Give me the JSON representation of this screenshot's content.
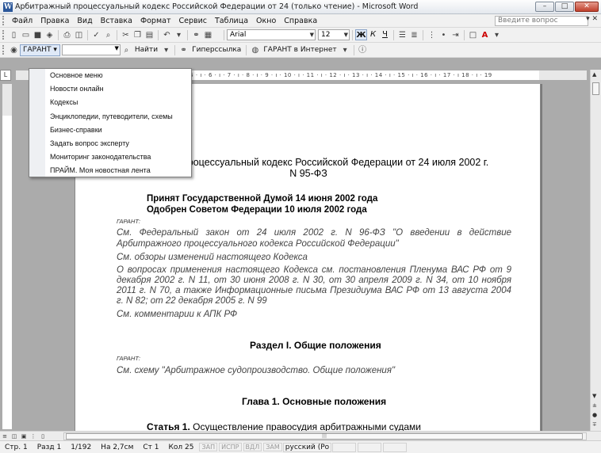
{
  "window": {
    "title": "Арбитражный процессуальный кодекс Российской Федерации от 24 (только чтение) - Microsoft Word"
  },
  "menubar": {
    "items": [
      "Файл",
      "Правка",
      "Вид",
      "Вставка",
      "Формат",
      "Сервис",
      "Таблица",
      "Окно",
      "Справка"
    ],
    "help_placeholder": "Введите вопрос"
  },
  "formatting": {
    "font_name": "Arial",
    "font_size": "12",
    "bold_label": "Ж",
    "italic_label": "К",
    "underline_label": "Ч"
  },
  "garant_toolbar": {
    "garant_label": "ГАРАНТ",
    "find_label": "Найти",
    "hyperlink_label": "Гиперссылка",
    "internet_label": "ГАРАНТ в Интернет"
  },
  "garant_menu": {
    "items": [
      "Основное меню",
      "Новости онлайн",
      "Кодексы",
      "Энциклопедии, путеводители, схемы",
      "Бизнес-справки",
      "Задать вопрос эксперту",
      "Мониторинг законодательства",
      "ПРАЙМ. Моя новостная лента"
    ]
  },
  "ruler": {
    "labels": "· 4 · ı · 5 · ı · 6 · ı · 7 · ı · 8 · ı · 9 · ı · 10 · ı · 11 · ı · 12 · ı · 13 · ı · 14 · ı · 15 · ı · 16 · ı · 17 · ı 18 · ı · 19"
  },
  "document": {
    "title_line1": "процессуальный кодекс Российской Федерации от 24 июля 2002 г.",
    "title_line2": "N 95-ФЗ",
    "adopted_duma": "Принят Государственной Думой 14 июня 2002 года",
    "approved_council": "Одобрен Советом Федерации 10 июля 2002 года",
    "garant_note_1": "ГАРАНТ:",
    "note_law": "См. Федеральный закон от 24 июля 2002 г. N 96-ФЗ \"О введении в действие Арбитражного процессуального кодекса Российской Федерации\"",
    "note_reviews": "См. обзоры изменений настоящего Кодекса",
    "note_plenum": "О вопросах применения настоящего Кодекса см. постановления Пленума ВАС РФ от 9 декабря 2002 г. N 11, от 30 июня 2008 г. N 30, от 30 апреля 2009 г. N 34, от 10 ноября 2011 г. N 70, а также Информационные письма Президиума ВАС РФ от 13 августа 2004 г. N 82; от 22 декабря 2005 г. N 99",
    "note_comments": "См. комментарии к АПК РФ",
    "section_title": "Раздел I. Общие положения",
    "garant_note_2": "ГАРАНТ:",
    "note_scheme": "См. схему \"Арбитражное судопроизводство. Общие положения\"",
    "chapter_title": "Глава 1. Основные положения",
    "article_label": "Статья 1.",
    "article_text": "Осуществление правосудия арбитражными судами"
  },
  "statusbar": {
    "page": "Стр. 1",
    "section": "Разд 1",
    "pages": "1/192",
    "position": "На 2,7см",
    "line": "Ст 1",
    "column": "Кол 25",
    "rec": "ЗАП",
    "trk": "ИСПР",
    "ext": "ВДЛ",
    "ovr": "ЗАМ",
    "language": "русский (Ро"
  }
}
